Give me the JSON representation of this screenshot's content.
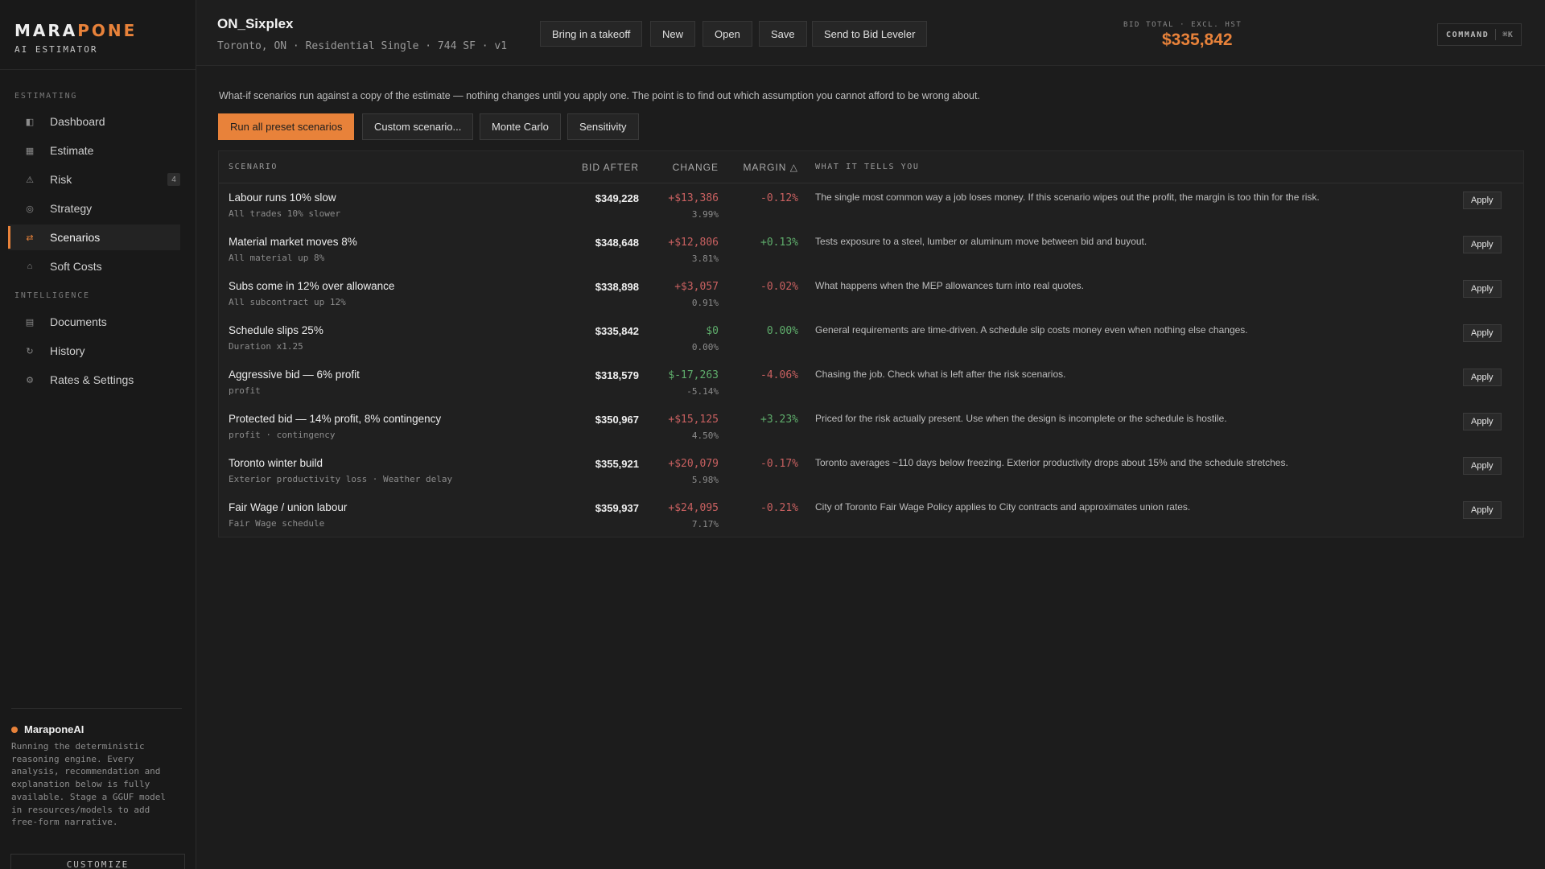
{
  "brand": {
    "name_a": "MARA",
    "name_b": "PONE",
    "subtitle": "AI ESTIMATOR"
  },
  "sidebar": {
    "sections": [
      "ESTIMATING",
      "INTELLIGENCE"
    ],
    "items": [
      {
        "label": "Dashboard",
        "icon": "dashboard-icon"
      },
      {
        "label": "Estimate",
        "icon": "estimate-icon"
      },
      {
        "label": "Risk",
        "icon": "warning-icon",
        "badge": "4"
      },
      {
        "label": "Strategy",
        "icon": "strategy-icon"
      },
      {
        "label": "Scenarios",
        "icon": "swap-icon",
        "active": true
      },
      {
        "label": "Soft Costs",
        "icon": "home-icon"
      },
      {
        "label": "Documents",
        "icon": "document-icon"
      },
      {
        "label": "History",
        "icon": "history-icon"
      },
      {
        "label": "Rates & Settings",
        "icon": "gear-icon"
      }
    ],
    "ai": {
      "title": "MaraponeAI",
      "text": "Running the deterministic reasoning engine. Every analysis, recommendation and explanation below is fully available. Stage a GGUF model in resources/models to add free-form narrative."
    },
    "customize": "CUSTOMIZE"
  },
  "header": {
    "title": "ON_Sixplex",
    "meta": "Toronto, ON · Residential Single · 744 SF · v1",
    "buttons": [
      "Bring in a takeoff",
      "New",
      "Open",
      "Save",
      "Send to Bid Leveler"
    ],
    "bid_label": "BID TOTAL · EXCL. HST",
    "bid_total": "$335,842",
    "command": "COMMAND",
    "command_kbd": "⌘K"
  },
  "main": {
    "intro": "What-if scenarios run against a copy of the estimate — nothing changes until you apply one. The point is to find out which assumption you cannot afford to be wrong about.",
    "toolbar": [
      "Run all preset scenarios",
      "Custom scenario...",
      "Monte Carlo",
      "Sensitivity"
    ],
    "columns": {
      "scenario": "SCENARIO",
      "bid_after": "BID AFTER",
      "change": "CHANGE",
      "margin": "MARGIN △",
      "tells": "WHAT IT TELLS YOU"
    },
    "apply_label": "Apply",
    "rows": [
      {
        "name": "Labour runs 10% slow",
        "sub": "All trades 10% slower",
        "bid": "$349,228",
        "change": "+$13,386",
        "pct": "3.99%",
        "margin": "-0.12%",
        "tells": "The single most common way a job loses money. If this scenario wipes out the profit, the margin is too thin for the risk.",
        "change_tone": "pos",
        "margin_tone": "pos"
      },
      {
        "name": "Material market moves 8%",
        "sub": "All material up 8%",
        "bid": "$348,648",
        "change": "+$12,806",
        "pct": "3.81%",
        "margin": "+0.13%",
        "tells": "Tests exposure to a steel, lumber or aluminum move between bid and buyout.",
        "change_tone": "pos",
        "margin_tone": "neg"
      },
      {
        "name": "Subs come in 12% over allowance",
        "sub": "All subcontract up 12%",
        "bid": "$338,898",
        "change": "+$3,057",
        "pct": "0.91%",
        "margin": "-0.02%",
        "tells": "What happens when the MEP allowances turn into real quotes.",
        "change_tone": "pos",
        "margin_tone": "pos"
      },
      {
        "name": "Schedule slips 25%",
        "sub": "Duration x1.25",
        "bid": "$335,842",
        "change": "$0",
        "pct": "0.00%",
        "margin": "0.00%",
        "tells": "General requirements are time-driven. A schedule slip costs money even when nothing else changes.",
        "change_tone": "zero",
        "margin_tone": "zero"
      },
      {
        "name": "Aggressive bid — 6% profit",
        "sub": "profit",
        "bid": "$318,579",
        "change": "$-17,263",
        "pct": "-5.14%",
        "margin": "-4.06%",
        "tells": "Chasing the job. Check what is left after the risk scenarios.",
        "change_tone": "neg",
        "margin_tone": "pos"
      },
      {
        "name": "Protected bid — 14% profit, 8% contingency",
        "sub": "profit · contingency",
        "bid": "$350,967",
        "change": "+$15,125",
        "pct": "4.50%",
        "margin": "+3.23%",
        "tells": "Priced for the risk actually present. Use when the design is incomplete or the schedule is hostile.",
        "change_tone": "pos",
        "margin_tone": "neg"
      },
      {
        "name": "Toronto winter build",
        "sub": "Exterior productivity loss · Weather delay",
        "bid": "$355,921",
        "change": "+$20,079",
        "pct": "5.98%",
        "margin": "-0.17%",
        "tells": "Toronto averages ~110 days below freezing. Exterior productivity drops about 15% and the schedule stretches.",
        "change_tone": "pos",
        "margin_tone": "pos"
      },
      {
        "name": "Fair Wage / union labour",
        "sub": "Fair Wage schedule",
        "bid": "$359,937",
        "change": "+$24,095",
        "pct": "7.17%",
        "margin": "-0.21%",
        "tells": "City of Toronto Fair Wage Policy applies to City contracts and approximates union rates.",
        "change_tone": "pos",
        "margin_tone": "pos"
      }
    ]
  },
  "colors": {
    "accent": "#e8823a",
    "positive_change": "#c86060",
    "negative_change": "#5fae6c"
  }
}
